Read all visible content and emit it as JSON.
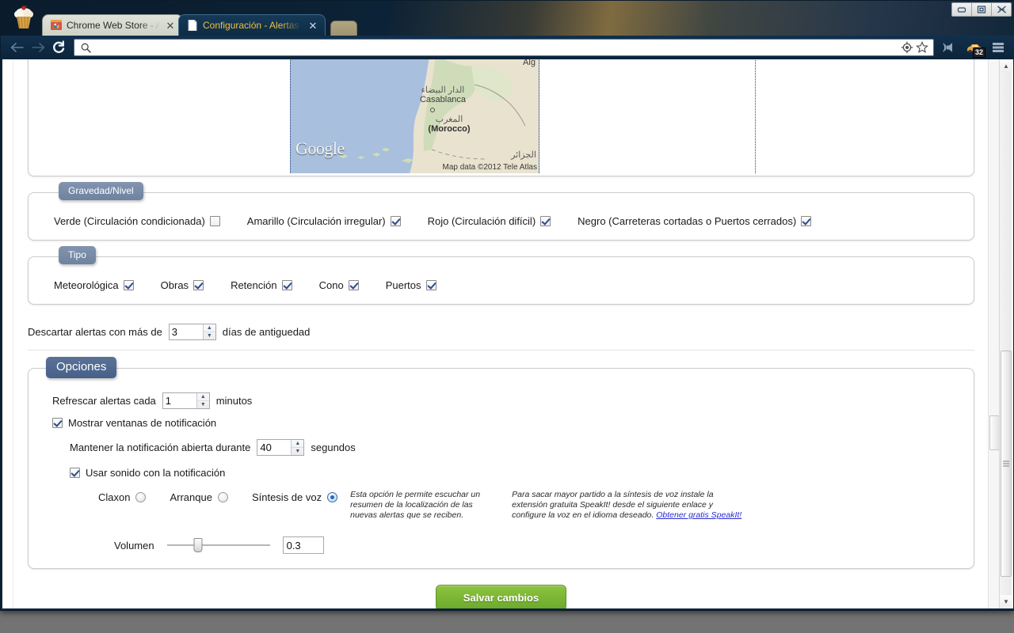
{
  "window": {
    "controls": [
      {
        "name": "minimize",
        "glyph": "▭"
      },
      {
        "name": "maximize",
        "glyph": "❐"
      },
      {
        "name": "close",
        "glyph": "✕"
      }
    ]
  },
  "browser": {
    "tabs": [
      {
        "title": "Chrome Web Store - Alert",
        "favicon": "chrome-webstore-icon",
        "active": false,
        "close_glyph": "✕"
      },
      {
        "title": "Configuración - Alertas de",
        "favicon": "page-icon",
        "active": true,
        "close_glyph": "✕"
      }
    ],
    "new_tab_label": "",
    "toolbar": {
      "back_glyph": "⇦",
      "forward_glyph": "⇨",
      "reload_glyph": "C",
      "omnibox_value": "",
      "omnibox_placeholder": "",
      "search_glyph": "🔍",
      "target_glyph": "◎",
      "star_glyph": "☆",
      "audio_glyph": "◖",
      "extension_badge": "32",
      "menu_glyph": "☰"
    }
  },
  "map": {
    "watermark": "Google",
    "attribution": "Map data ©2012 Tele Atlas",
    "labels": [
      {
        "ar": "الدار البيضاء",
        "en": "Casablanca",
        "bold": false
      },
      {
        "ar": "المغرب",
        "en": "(Morocco)",
        "bold": true
      },
      {
        "ar": "الجزائر",
        "en": "Alg",
        "bold": false
      },
      {
        "ar": "",
        "en": "Alg",
        "bold": false
      }
    ]
  },
  "sections": {
    "severity": {
      "legend": "Gravedad/Nivel",
      "items": [
        {
          "label": "Verde (Circulación condicionada)",
          "checked": false
        },
        {
          "label": "Amarillo (Circulación irregular)",
          "checked": true
        },
        {
          "label": "Rojo (Circulación difícil)",
          "checked": true
        },
        {
          "label": "Negro (Carreteras cortadas o Puertos cerrados)",
          "checked": true
        }
      ]
    },
    "type": {
      "legend": "Tipo",
      "items": [
        {
          "label": "Meteorológica",
          "checked": true
        },
        {
          "label": "Obras",
          "checked": true
        },
        {
          "label": "Retención",
          "checked": true
        },
        {
          "label": "Cono",
          "checked": true
        },
        {
          "label": "Puertos",
          "checked": true
        }
      ]
    },
    "discard": {
      "prefix": "Descartar alertas con más de",
      "value": "3",
      "suffix": "días de antiguedad"
    },
    "options": {
      "legend": "Opciones",
      "refresh": {
        "prefix": "Refrescar alertas cada",
        "value": "1",
        "suffix": "minutos"
      },
      "show_notifications": {
        "label": "Mostrar ventanas de notificación",
        "checked": true
      },
      "keep_open": {
        "prefix": "Mantener la notificación abierta durante",
        "value": "40",
        "suffix": "segundos"
      },
      "use_sound": {
        "label": "Usar sonido con la notificación",
        "checked": true
      },
      "sound_modes": [
        {
          "label": "Claxon",
          "selected": false
        },
        {
          "label": "Arranque",
          "selected": false
        },
        {
          "label": "Síntesis de voz",
          "selected": true
        }
      ],
      "tts_note": "Esta opción le permite escuchar un resumen de la localización de las nuevas alertas que se reciben.",
      "speakit_note": "Para sacar mayor partido a la síntesis de voz instale la extensión gratuita SpeakIt! desde el siguiente enlace y configure la voz en el idioma deseado.",
      "speakit_link": "Obtener gratis SpeakIt!",
      "volume": {
        "label": "Volumen",
        "value": "0.3",
        "percent": 30
      }
    },
    "save_button": "Salvar cambios"
  },
  "colors": {
    "accent": "#6e83a1",
    "legend_big": "#47608a",
    "save_green": "#6aa82c",
    "tab_active_text": "#f0c040",
    "link": "#2b2bd0"
  }
}
